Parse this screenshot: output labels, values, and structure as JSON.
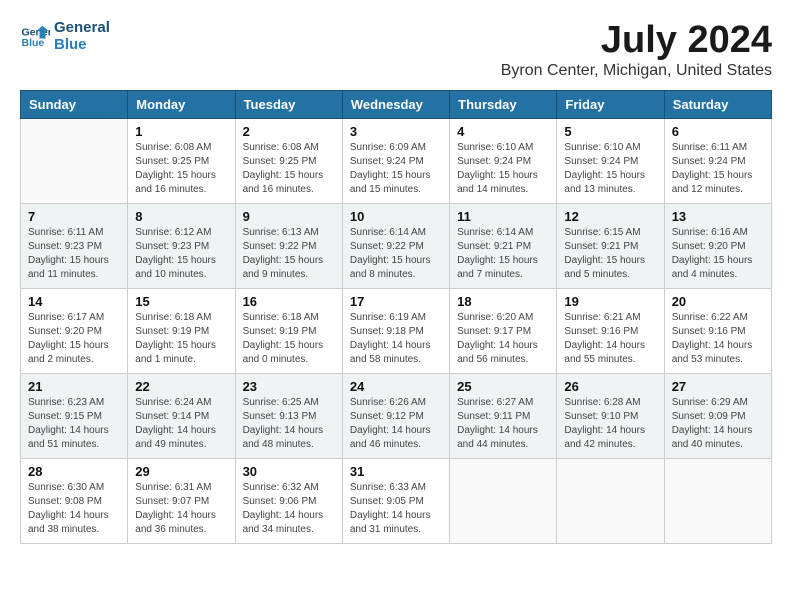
{
  "header": {
    "logo_line1": "General",
    "logo_line2": "Blue",
    "month_title": "July 2024",
    "location": "Byron Center, Michigan, United States"
  },
  "days_of_week": [
    "Sunday",
    "Monday",
    "Tuesday",
    "Wednesday",
    "Thursday",
    "Friday",
    "Saturday"
  ],
  "weeks": [
    [
      {
        "day": "",
        "info": ""
      },
      {
        "day": "1",
        "info": "Sunrise: 6:08 AM\nSunset: 9:25 PM\nDaylight: 15 hours\nand 16 minutes."
      },
      {
        "day": "2",
        "info": "Sunrise: 6:08 AM\nSunset: 9:25 PM\nDaylight: 15 hours\nand 16 minutes."
      },
      {
        "day": "3",
        "info": "Sunrise: 6:09 AM\nSunset: 9:24 PM\nDaylight: 15 hours\nand 15 minutes."
      },
      {
        "day": "4",
        "info": "Sunrise: 6:10 AM\nSunset: 9:24 PM\nDaylight: 15 hours\nand 14 minutes."
      },
      {
        "day": "5",
        "info": "Sunrise: 6:10 AM\nSunset: 9:24 PM\nDaylight: 15 hours\nand 13 minutes."
      },
      {
        "day": "6",
        "info": "Sunrise: 6:11 AM\nSunset: 9:24 PM\nDaylight: 15 hours\nand 12 minutes."
      }
    ],
    [
      {
        "day": "7",
        "info": "Sunrise: 6:11 AM\nSunset: 9:23 PM\nDaylight: 15 hours\nand 11 minutes."
      },
      {
        "day": "8",
        "info": "Sunrise: 6:12 AM\nSunset: 9:23 PM\nDaylight: 15 hours\nand 10 minutes."
      },
      {
        "day": "9",
        "info": "Sunrise: 6:13 AM\nSunset: 9:22 PM\nDaylight: 15 hours\nand 9 minutes."
      },
      {
        "day": "10",
        "info": "Sunrise: 6:14 AM\nSunset: 9:22 PM\nDaylight: 15 hours\nand 8 minutes."
      },
      {
        "day": "11",
        "info": "Sunrise: 6:14 AM\nSunset: 9:21 PM\nDaylight: 15 hours\nand 7 minutes."
      },
      {
        "day": "12",
        "info": "Sunrise: 6:15 AM\nSunset: 9:21 PM\nDaylight: 15 hours\nand 5 minutes."
      },
      {
        "day": "13",
        "info": "Sunrise: 6:16 AM\nSunset: 9:20 PM\nDaylight: 15 hours\nand 4 minutes."
      }
    ],
    [
      {
        "day": "14",
        "info": "Sunrise: 6:17 AM\nSunset: 9:20 PM\nDaylight: 15 hours\nand 2 minutes."
      },
      {
        "day": "15",
        "info": "Sunrise: 6:18 AM\nSunset: 9:19 PM\nDaylight: 15 hours\nand 1 minute."
      },
      {
        "day": "16",
        "info": "Sunrise: 6:18 AM\nSunset: 9:19 PM\nDaylight: 15 hours\nand 0 minutes."
      },
      {
        "day": "17",
        "info": "Sunrise: 6:19 AM\nSunset: 9:18 PM\nDaylight: 14 hours\nand 58 minutes."
      },
      {
        "day": "18",
        "info": "Sunrise: 6:20 AM\nSunset: 9:17 PM\nDaylight: 14 hours\nand 56 minutes."
      },
      {
        "day": "19",
        "info": "Sunrise: 6:21 AM\nSunset: 9:16 PM\nDaylight: 14 hours\nand 55 minutes."
      },
      {
        "day": "20",
        "info": "Sunrise: 6:22 AM\nSunset: 9:16 PM\nDaylight: 14 hours\nand 53 minutes."
      }
    ],
    [
      {
        "day": "21",
        "info": "Sunrise: 6:23 AM\nSunset: 9:15 PM\nDaylight: 14 hours\nand 51 minutes."
      },
      {
        "day": "22",
        "info": "Sunrise: 6:24 AM\nSunset: 9:14 PM\nDaylight: 14 hours\nand 49 minutes."
      },
      {
        "day": "23",
        "info": "Sunrise: 6:25 AM\nSunset: 9:13 PM\nDaylight: 14 hours\nand 48 minutes."
      },
      {
        "day": "24",
        "info": "Sunrise: 6:26 AM\nSunset: 9:12 PM\nDaylight: 14 hours\nand 46 minutes."
      },
      {
        "day": "25",
        "info": "Sunrise: 6:27 AM\nSunset: 9:11 PM\nDaylight: 14 hours\nand 44 minutes."
      },
      {
        "day": "26",
        "info": "Sunrise: 6:28 AM\nSunset: 9:10 PM\nDaylight: 14 hours\nand 42 minutes."
      },
      {
        "day": "27",
        "info": "Sunrise: 6:29 AM\nSunset: 9:09 PM\nDaylight: 14 hours\nand 40 minutes."
      }
    ],
    [
      {
        "day": "28",
        "info": "Sunrise: 6:30 AM\nSunset: 9:08 PM\nDaylight: 14 hours\nand 38 minutes."
      },
      {
        "day": "29",
        "info": "Sunrise: 6:31 AM\nSunset: 9:07 PM\nDaylight: 14 hours\nand 36 minutes."
      },
      {
        "day": "30",
        "info": "Sunrise: 6:32 AM\nSunset: 9:06 PM\nDaylight: 14 hours\nand 34 minutes."
      },
      {
        "day": "31",
        "info": "Sunrise: 6:33 AM\nSunset: 9:05 PM\nDaylight: 14 hours\nand 31 minutes."
      },
      {
        "day": "",
        "info": ""
      },
      {
        "day": "",
        "info": ""
      },
      {
        "day": "",
        "info": ""
      }
    ]
  ]
}
